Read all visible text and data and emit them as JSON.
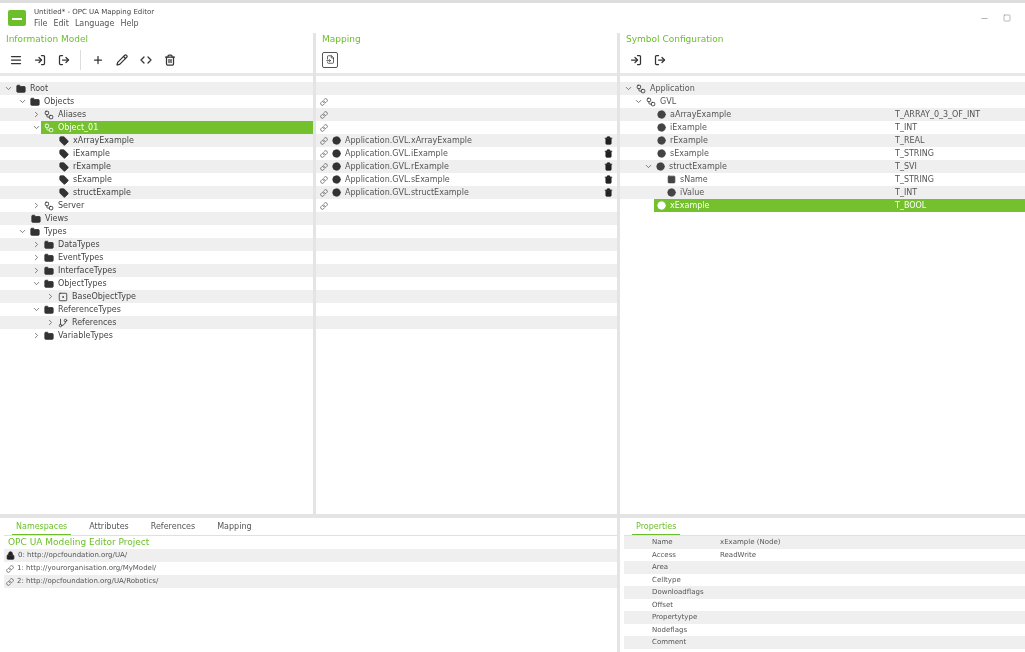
{
  "window": {
    "title": "Untitled* - OPC UA Mapping Editor"
  },
  "menu": [
    "File",
    "Edit",
    "Language",
    "Help"
  ],
  "information_model": {
    "title": "Information Model",
    "tree": [
      {
        "label": "Root",
        "kind": "folder",
        "expanded": true,
        "selected": false,
        "children": [
          {
            "label": "Objects",
            "kind": "folder",
            "expanded": true,
            "selected": false,
            "children": [
              {
                "label": "Aliases",
                "kind": "object",
                "expanded": false,
                "selected": false
              },
              {
                "label": "Object_01",
                "kind": "object",
                "expanded": true,
                "selected": true,
                "children": [
                  {
                    "label": "xArrayExample",
                    "kind": "variable",
                    "selected": false
                  },
                  {
                    "label": "iExample",
                    "kind": "variable",
                    "selected": false
                  },
                  {
                    "label": "rExample",
                    "kind": "variable",
                    "selected": false
                  },
                  {
                    "label": "sExample",
                    "kind": "variable",
                    "selected": false
                  },
                  {
                    "label": "structExample",
                    "kind": "variable",
                    "selected": false
                  }
                ]
              },
              {
                "label": "Server",
                "kind": "object",
                "expanded": false,
                "selected": false
              }
            ]
          },
          {
            "label": "Views",
            "kind": "folder",
            "selected": false
          },
          {
            "label": "Types",
            "kind": "folder",
            "expanded": true,
            "selected": false,
            "children": [
              {
                "label": "DataTypes",
                "kind": "folder",
                "expanded": false,
                "selected": false
              },
              {
                "label": "EventTypes",
                "kind": "folder",
                "expanded": false,
                "selected": false
              },
              {
                "label": "InterfaceTypes",
                "kind": "folder",
                "expanded": false,
                "selected": false
              },
              {
                "label": "ObjectTypes",
                "kind": "folder",
                "expanded": true,
                "selected": false,
                "children": [
                  {
                    "label": "BaseObjectType",
                    "kind": "type",
                    "expanded": false,
                    "selected": false
                  }
                ]
              },
              {
                "label": "ReferenceTypes",
                "kind": "folder",
                "expanded": true,
                "selected": false,
                "children": [
                  {
                    "label": "References",
                    "kind": "reference",
                    "expanded": false,
                    "selected": false
                  }
                ]
              },
              {
                "label": "VariableTypes",
                "kind": "folder",
                "expanded": false,
                "selected": false
              }
            ]
          }
        ]
      }
    ]
  },
  "mapping": {
    "title": "Mapping",
    "rows": [
      {
        "linked": false
      },
      {
        "linked": true
      },
      {
        "linked": true
      },
      {
        "linked": true
      },
      {
        "linked": true,
        "target": "Application.GVL.xArrayExample"
      },
      {
        "linked": true,
        "target": "Application.GVL.iExample"
      },
      {
        "linked": true,
        "target": "Application.GVL.rExample"
      },
      {
        "linked": true,
        "target": "Application.GVL.sExample"
      },
      {
        "linked": true,
        "target": "Application.GVL.structExample"
      },
      {
        "linked": true
      }
    ]
  },
  "symbol_configuration": {
    "title": "Symbol Configuration",
    "tree": [
      {
        "label": "Application",
        "kind": "object",
        "expanded": true,
        "selected": false,
        "children": [
          {
            "label": "GVL",
            "kind": "object",
            "expanded": true,
            "selected": false,
            "children": [
              {
                "label": "aArrayExample",
                "type": "T_ARRAY_0_3_OF_INT",
                "kind": "variable",
                "selected": false
              },
              {
                "label": "iExample",
                "type": "T_INT",
                "kind": "variable",
                "selected": false
              },
              {
                "label": "rExample",
                "type": "T_REAL",
                "kind": "variable",
                "selected": false
              },
              {
                "label": "sExample",
                "type": "T_STRING",
                "kind": "variable",
                "selected": false
              },
              {
                "label": "structExample",
                "type": "T_SVI",
                "kind": "variable",
                "expanded": true,
                "selected": false,
                "children": [
                  {
                    "label": "sName",
                    "type": "T_STRING",
                    "kind": "square",
                    "selected": false
                  },
                  {
                    "label": "iValue",
                    "type": "T_INT",
                    "kind": "variable",
                    "selected": false
                  }
                ]
              },
              {
                "label": "xExample",
                "type": "T_BOOL",
                "kind": "variable",
                "selected": true
              }
            ]
          }
        ]
      }
    ]
  },
  "bottom_left": {
    "tabs": [
      {
        "label": "Namespaces",
        "selected": true
      },
      {
        "label": "Attributes",
        "selected": false
      },
      {
        "label": "References",
        "selected": false
      },
      {
        "label": "Mapping",
        "selected": false
      }
    ],
    "project_title": "OPC UA Modeling Editor Project",
    "namespaces": [
      {
        "label": "0: http://opcfoundation.org/UA/",
        "locked": true
      },
      {
        "label": "1: http://yourorganisation.org/MyModel/",
        "locked": false
      },
      {
        "label": "2: http://opcfoundation.org/UA/Robotics/",
        "locked": false
      }
    ]
  },
  "properties": {
    "tabs": [
      {
        "label": "Properties",
        "selected": true
      }
    ],
    "rows": [
      {
        "name": "Name",
        "value": "xExample (Node)"
      },
      {
        "name": "Access",
        "value": "ReadWrite"
      },
      {
        "name": "Area"
      },
      {
        "name": "Celltype"
      },
      {
        "name": "Downloadflags"
      },
      {
        "name": "Offset"
      },
      {
        "name": "Propertytype"
      },
      {
        "name": "Nodeflags"
      },
      {
        "name": "Comment"
      }
    ]
  }
}
